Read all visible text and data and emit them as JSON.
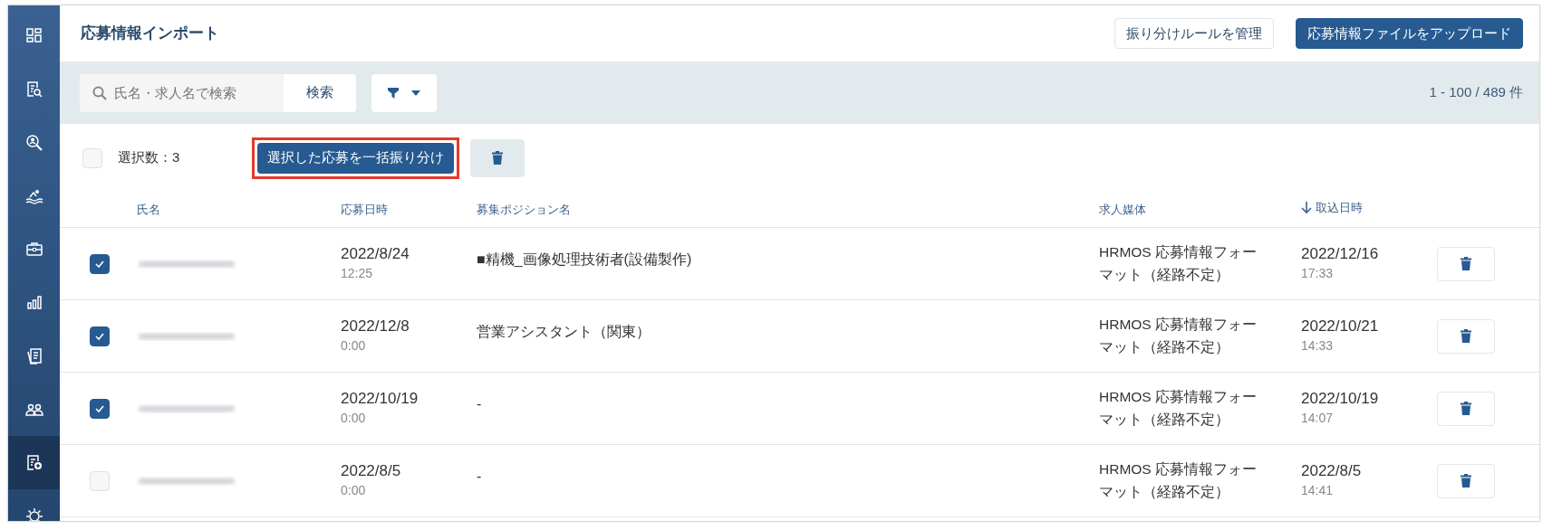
{
  "sidebar": {
    "items": [
      {
        "selected": false
      },
      {
        "selected": false
      },
      {
        "selected": false
      },
      {
        "selected": false
      },
      {
        "selected": false
      },
      {
        "selected": false
      },
      {
        "selected": false
      },
      {
        "selected": false
      },
      {
        "selected": true
      },
      {
        "selected": false
      }
    ]
  },
  "page": {
    "title": "応募情報インポート"
  },
  "header_buttons": [
    {
      "label": "振り分けルールを管理",
      "kind": "outline"
    },
    {
      "label": "応募情報ファイルをアップロード",
      "kind": "primary"
    }
  ],
  "search": {
    "placeholder": "氏名・求人名で検索",
    "button": "検索"
  },
  "result_count": "1 - 100 / 489 件",
  "selection": {
    "all_checked": false,
    "count_label": "選択数：3",
    "bulk_button": {
      "label": "選択した応募を一括振り分け",
      "highlighted": true
    }
  },
  "table": {
    "columns": [
      {
        "label": "氏名",
        "sorted": false
      },
      {
        "label": "応募日時",
        "sorted": false
      },
      {
        "label": "募集ポジション名",
        "sorted": false
      },
      {
        "label": "求人媒体",
        "sorted": false
      },
      {
        "label": "取込日時",
        "sorted": true
      }
    ],
    "rows": [
      {
        "checked": true,
        "date": "2022/8/24",
        "time": "12:25",
        "position": "■精機_画像処理技術者(設備製作)",
        "media": "HRMOS 応募情報フォーマット（経路不定）",
        "import_date": "2022/12/16",
        "import_time": "17:33"
      },
      {
        "checked": true,
        "date": "2022/12/8",
        "time": "0:00",
        "position": "営業アシスタント（関東）",
        "media": "HRMOS 応募情報フォーマット（経路不定）",
        "import_date": "2022/10/21",
        "import_time": "14:33"
      },
      {
        "checked": true,
        "date": "2022/10/19",
        "time": "0:00",
        "position": "-",
        "media": "HRMOS 応募情報フォーマット（経路不定）",
        "import_date": "2022/10/19",
        "import_time": "14:07"
      },
      {
        "checked": false,
        "date": "2022/8/5",
        "time": "0:00",
        "position": "-",
        "media": "HRMOS 応募情報フォーマット（経路不定）",
        "import_date": "2022/8/5",
        "import_time": "14:41"
      }
    ]
  }
}
